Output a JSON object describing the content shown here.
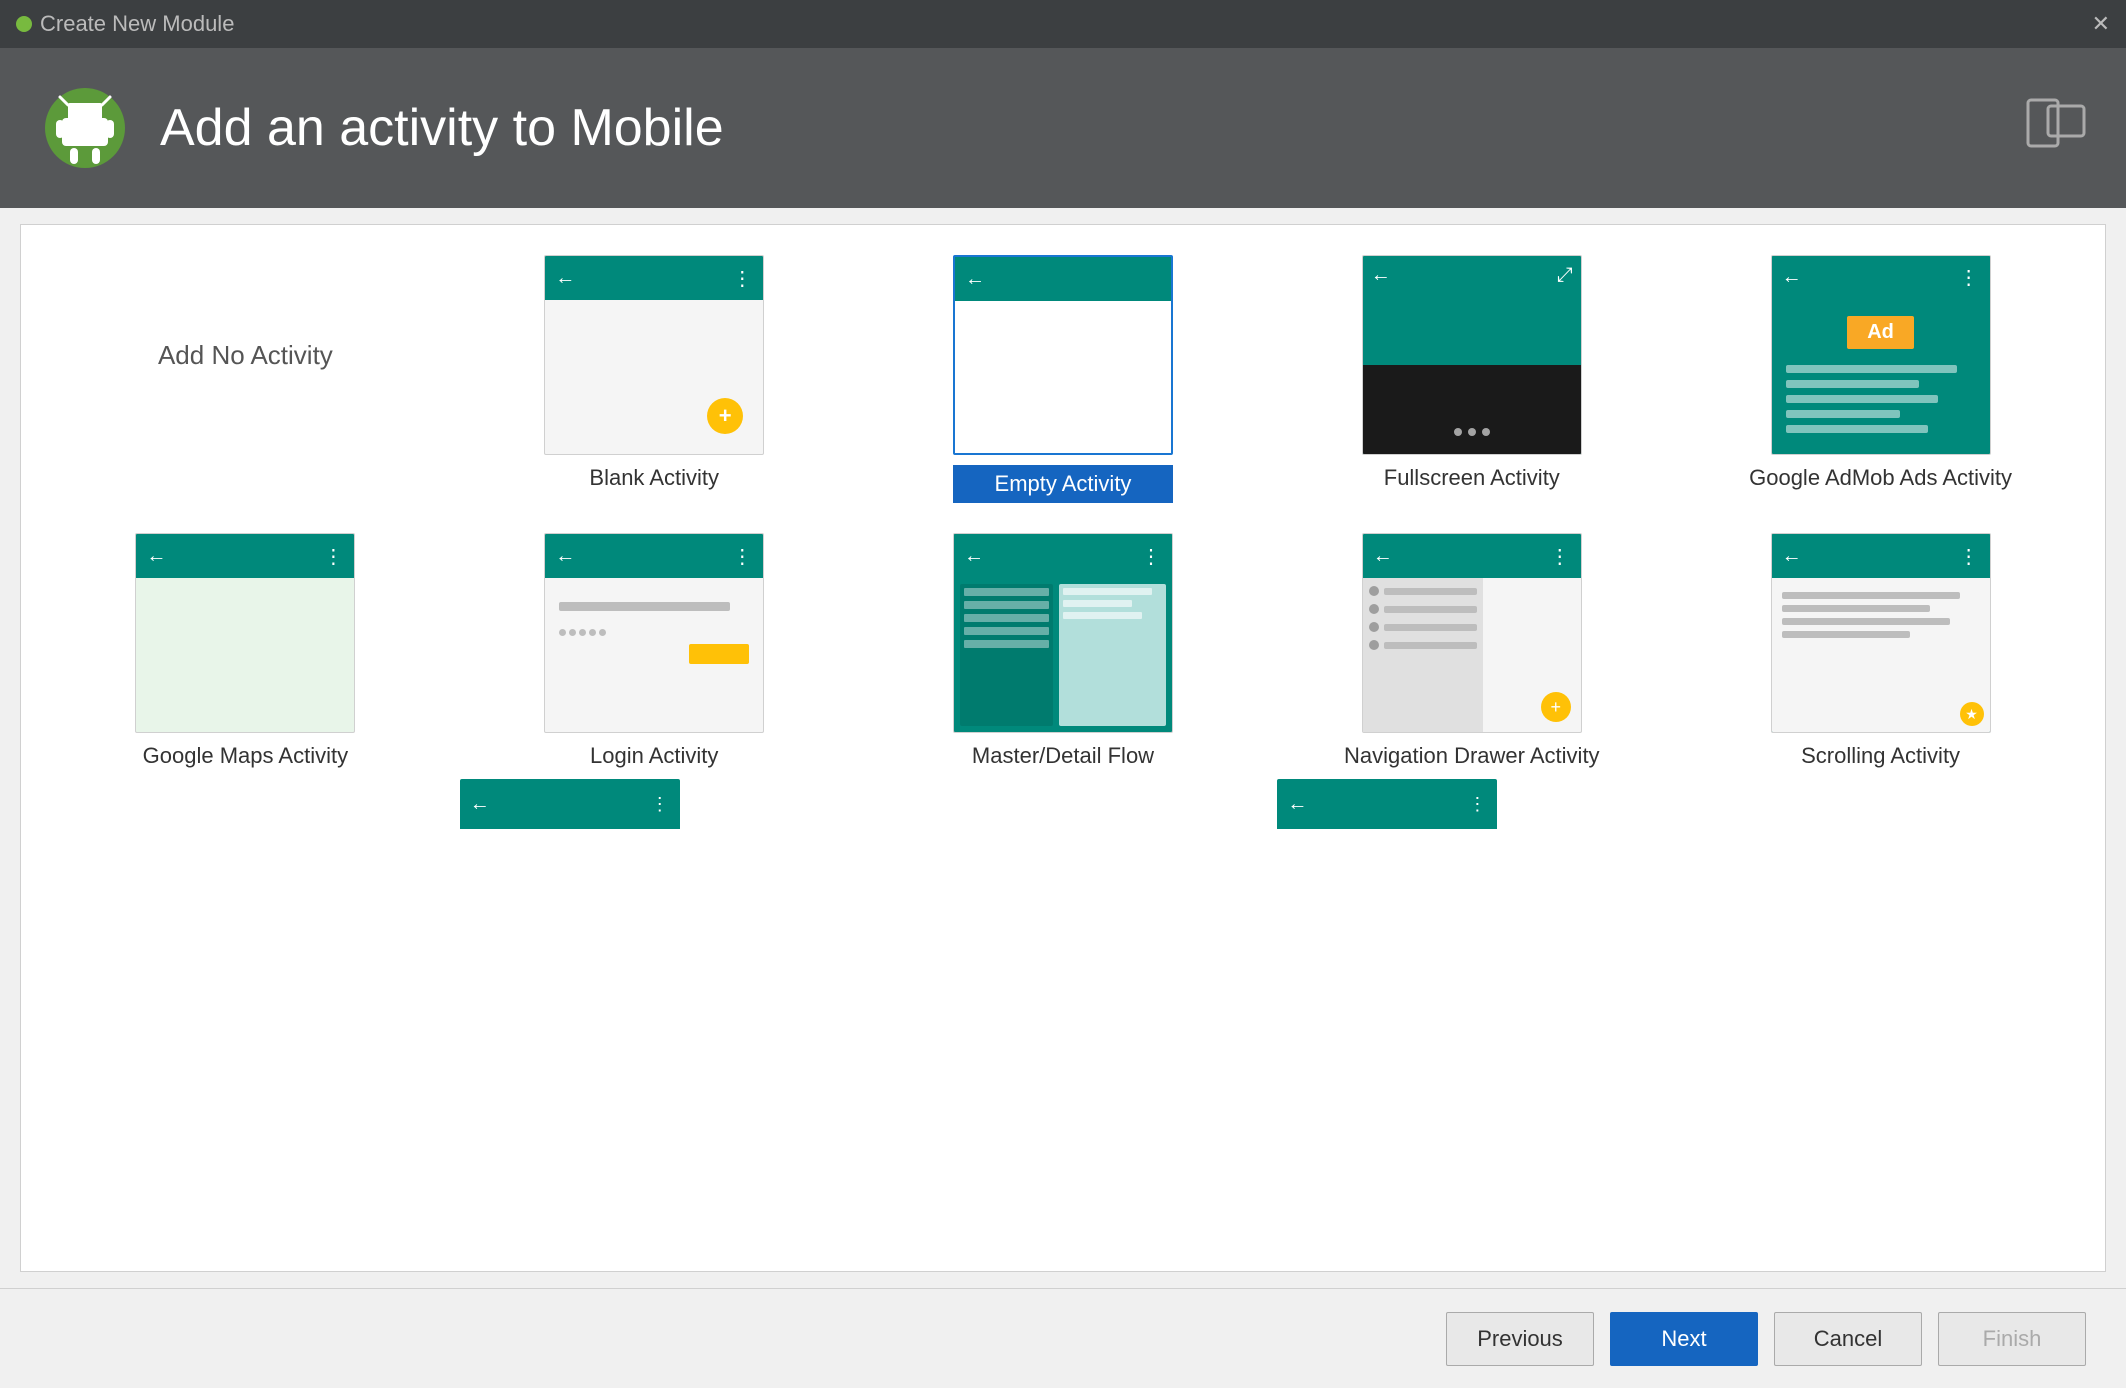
{
  "titleBar": {
    "title": "Create New Module",
    "closeLabel": "✕"
  },
  "header": {
    "title": "Add an activity to Mobile",
    "deviceIconLabel": "⬜⬜"
  },
  "grid": {
    "items": [
      {
        "id": "no-activity",
        "label": "Add No Activity",
        "type": "none"
      },
      {
        "id": "blank-activity",
        "label": "Blank Activity",
        "type": "blank"
      },
      {
        "id": "empty-activity",
        "label": "Empty Activity",
        "type": "empty",
        "selected": true
      },
      {
        "id": "fullscreen-activity",
        "label": "Fullscreen Activity",
        "type": "fullscreen"
      },
      {
        "id": "admob-activity",
        "label": "Google AdMob Ads Activity",
        "type": "admob"
      },
      {
        "id": "maps-activity",
        "label": "Google Maps Activity",
        "type": "maps"
      },
      {
        "id": "login-activity",
        "label": "Login Activity",
        "type": "login"
      },
      {
        "id": "master-detail",
        "label": "Master/Detail Flow",
        "type": "master-detail"
      },
      {
        "id": "nav-drawer",
        "label": "Navigation Drawer Activity",
        "type": "nav-drawer"
      },
      {
        "id": "scrolling-activity",
        "label": "Scrolling Activity",
        "type": "scrolling"
      }
    ]
  },
  "footer": {
    "previousLabel": "Previous",
    "nextLabel": "Next",
    "cancelLabel": "Cancel",
    "finishLabel": "Finish"
  }
}
